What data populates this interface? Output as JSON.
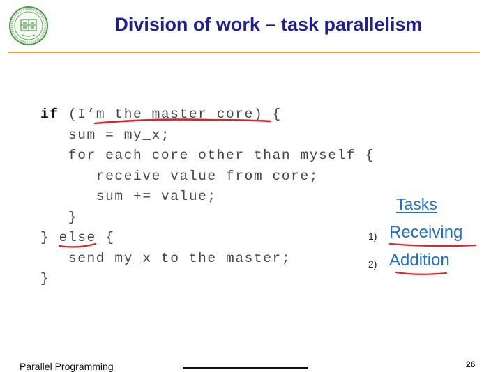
{
  "slide": {
    "title": "Division of work – task parallelism",
    "logo_icon": "university-seal-icon",
    "code_lines": [
      "if (I’m the master core) {",
      "   sum = my_x;",
      "   for each core other than myself {",
      "      receive value from core;",
      "      sum += value;",
      "   }",
      "} else {",
      "   send my_x to the master;",
      "}"
    ],
    "tasks": {
      "heading": "Tasks",
      "items": [
        {
          "number": "1)",
          "label": "Receiving"
        },
        {
          "number": "2)",
          "label": "Addition"
        }
      ]
    },
    "footer": {
      "course": "Parallel Programming",
      "page": "26"
    },
    "colors": {
      "title": "#1f1f8f",
      "title_rule": "#f0a020",
      "task_text": "#1f6fd0",
      "annotation_ink": "#d8262c"
    }
  }
}
